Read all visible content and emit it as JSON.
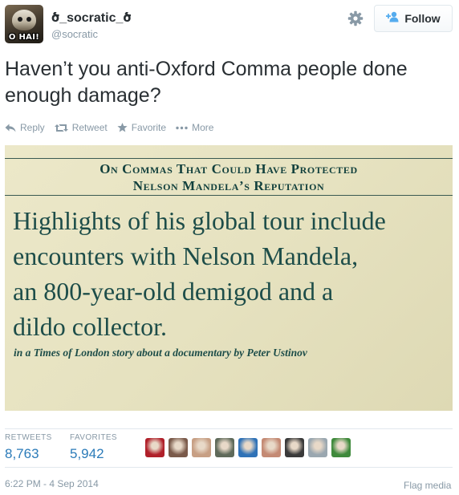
{
  "user": {
    "display_name": "ծ_socratic_ծ",
    "screen_name": "@socratic",
    "avatar_caption": "O HAI!"
  },
  "header": {
    "follow_label": "Follow",
    "settings_icon": "gear-icon",
    "follow_icon": "add-person-icon"
  },
  "tweet": {
    "text": "Haven’t you anti-Oxford Comma people done enough damage?"
  },
  "actions": [
    {
      "label": "Reply",
      "icon": "reply-icon"
    },
    {
      "label": "Retweet",
      "icon": "retweet-icon"
    },
    {
      "label": "Favorite",
      "icon": "star-icon"
    },
    {
      "label": "More",
      "icon": "more-icon"
    }
  ],
  "photo": {
    "headline_line1": "On Commas That Could Have Protected",
    "headline_line2": "Nelson Mandela’s Reputation",
    "quote_line1": "Highlights of his global tour include",
    "quote_line2": "encounters with Nelson Mandela,",
    "quote_line3": "an 800-year-old demigod and a",
    "quote_line4": "dildo collector.",
    "attribution": "in a Times of London story about a documentary by Peter Ustinov"
  },
  "stats": {
    "retweets_label": "RETWEETS",
    "retweets_value": "8,763",
    "favorites_label": "FAVORITES",
    "favorites_value": "5,942"
  },
  "favoriters": [
    {
      "color": "#b0202a"
    },
    {
      "color": "#7a5a4a"
    },
    {
      "color": "#c79f84"
    },
    {
      "color": "#5f6a5a"
    },
    {
      "color": "#2f72b7"
    },
    {
      "color": "#c48a74"
    },
    {
      "color": "#3a3a3a"
    },
    {
      "color": "#9aa7b0"
    },
    {
      "color": "#3f8a3c"
    }
  ],
  "footer": {
    "timestamp": "6:22 PM - 4 Sep 2014",
    "flag_label": "Flag media"
  },
  "colors": {
    "link_blue": "#2b7bb9",
    "muted_gray": "#8899a6",
    "text_dark": "#292f33",
    "photo_ink": "#1d4d49",
    "photo_paper": "#e6e2c0"
  }
}
